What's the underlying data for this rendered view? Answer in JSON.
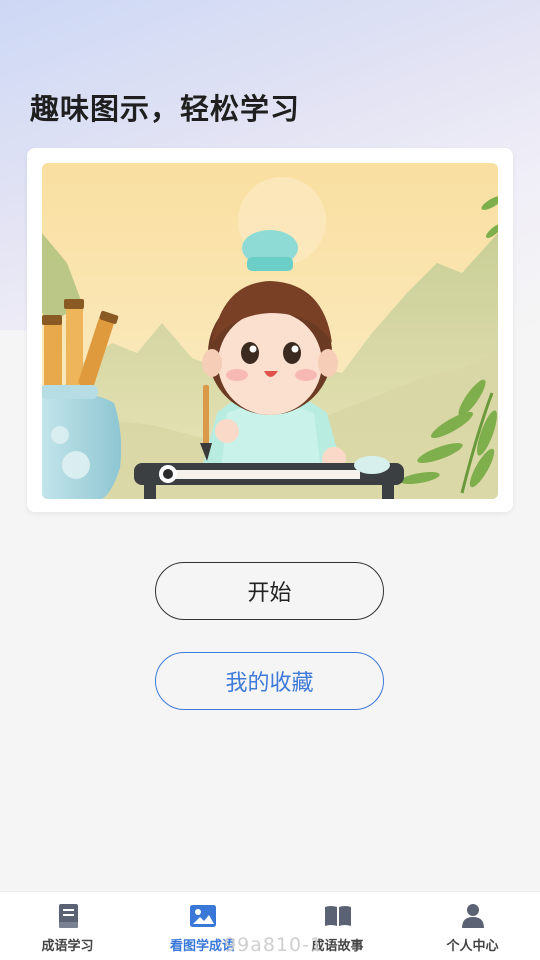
{
  "header": {
    "title": "趣味图示，轻松学习"
  },
  "card": {
    "illustration": "child-calligraphy-illustration"
  },
  "actions": {
    "start_label": "开始",
    "favorites_label": "我的收藏"
  },
  "tabbar": {
    "items": [
      {
        "label": "成语学习",
        "icon": "book-icon",
        "active": false
      },
      {
        "label": "看图学成语",
        "icon": "image-icon",
        "active": true
      },
      {
        "label": "成语故事",
        "icon": "open-book-icon",
        "active": false
      },
      {
        "label": "个人中心",
        "icon": "user-icon",
        "active": false
      }
    ]
  },
  "watermark": "99a810-1",
  "colors": {
    "accent": "#3a78d8",
    "tab_inactive": "#5b6273",
    "button_dark_border": "#333333"
  }
}
